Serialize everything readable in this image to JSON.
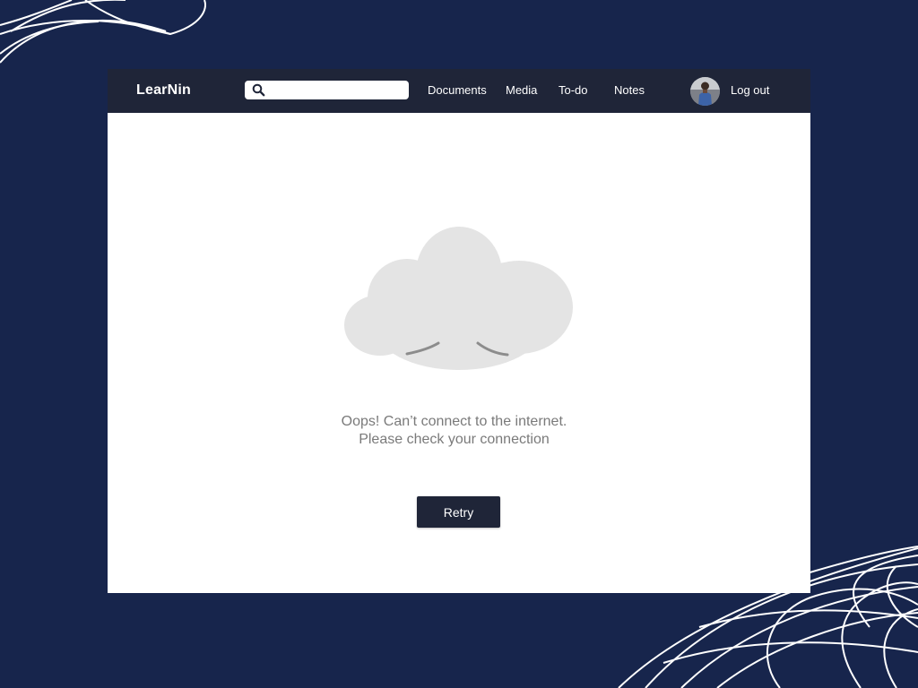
{
  "app": {
    "brand": "LearNin"
  },
  "search": {
    "value": "",
    "placeholder": "",
    "icon": "search-icon"
  },
  "nav": {
    "items": [
      {
        "label": "Documents"
      },
      {
        "label": "Media"
      },
      {
        "label": "To-do"
      },
      {
        "label": "Notes"
      }
    ],
    "logout_label": "Log out",
    "avatar_icon": "user-avatar"
  },
  "error": {
    "illustration": "sad-cloud-icon",
    "message": "Oops! Can’t connect to the internet. Please check your connection",
    "retry_label": "Retry"
  },
  "colors": {
    "background": "#17254c",
    "navbar": "#1f2538",
    "button": "#1f2538",
    "cloud": "#e4e4e4",
    "face": "#8c8c8c",
    "message_text": "#7a7a7a"
  }
}
